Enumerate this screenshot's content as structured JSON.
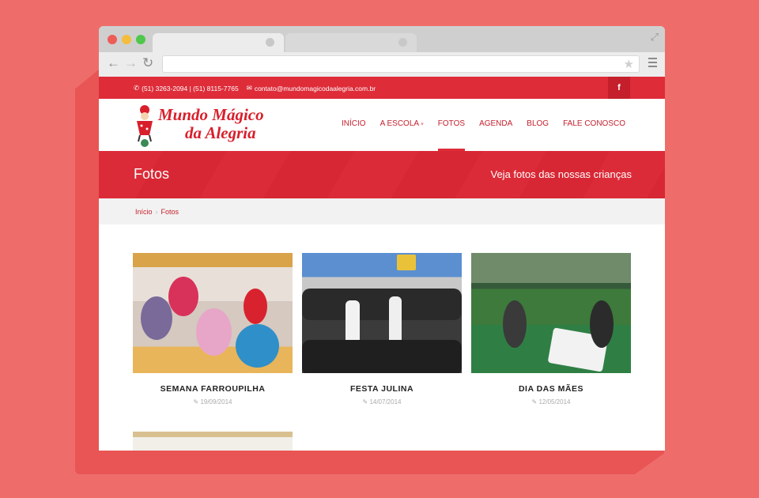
{
  "site": {
    "topbar": {
      "phone": "(51) 3263-2094 | (51) 8115-7765",
      "email": "contato@mundomagicodaalegria.com.br",
      "facebook": "f"
    },
    "logo": {
      "line1": "Mundo Mágico",
      "line2": "da Alegria"
    },
    "nav": [
      {
        "label": "INÍCIO"
      },
      {
        "label": "A ESCOLA"
      },
      {
        "label": "FOTOS"
      },
      {
        "label": "AGENDA"
      },
      {
        "label": "BLOG"
      },
      {
        "label": "FALE CONOSCO"
      }
    ],
    "banner": {
      "title": "Fotos",
      "subtitle": "Veja fotos das nossas crianças"
    },
    "breadcrumb": {
      "home": "Início",
      "sep": "›",
      "current": "Fotos"
    },
    "albums": [
      {
        "name": "SEMANA FARROUPILHA",
        "date": "19/09/2014"
      },
      {
        "name": "FESTA JULINA",
        "date": "14/07/2014"
      },
      {
        "name": "DIA DAS MÃES",
        "date": "12/05/2014"
      }
    ]
  },
  "colors": {
    "brand": "#de2c39",
    "background": "#ee6d6b"
  }
}
